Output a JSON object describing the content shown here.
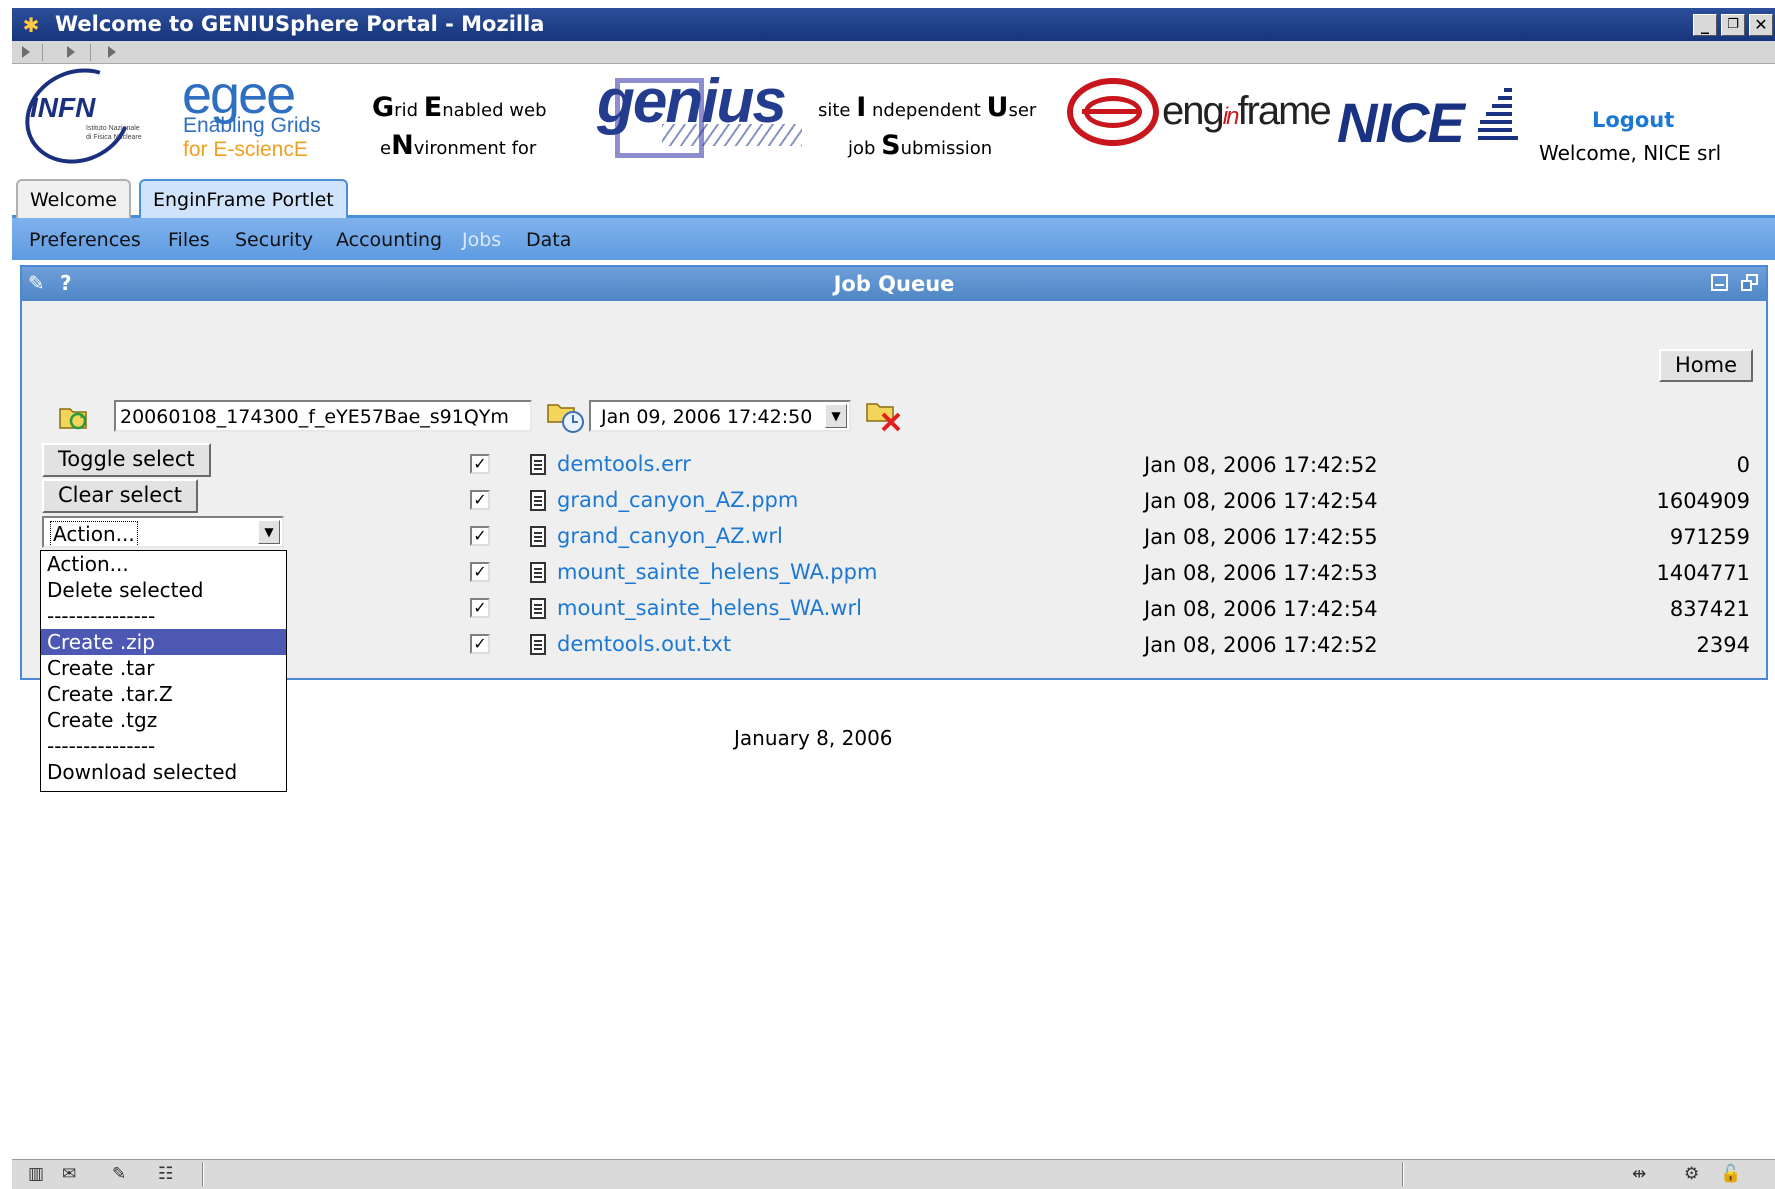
{
  "window": {
    "title": "Welcome to GENIUSphere Portal - Mozilla",
    "controls": [
      "_",
      "❐",
      "✕"
    ]
  },
  "header": {
    "infn": {
      "name": "INFN",
      "small_line1": "Istituto Nazionale",
      "small_line2": "di Fisica Nucleare"
    },
    "egee": {
      "name": "egee",
      "line1": "Enabling Grids",
      "line2": "for E-sciencE"
    },
    "genius_acronym": {
      "g": "G",
      "g_rest": "rid ",
      "e": "E",
      "e_rest": "nabled web",
      "e2": "e",
      "n": "N",
      "n_rest": "vironment for"
    },
    "genius_logo": "genius",
    "iuser_acronym": {
      "site": "site ",
      "i": "I",
      "i_rest": " ndependent ",
      "u": "U",
      "u_rest": "ser",
      "job": "job ",
      "s": "S",
      "s_rest": "ubmission"
    },
    "enginframe": {
      "pre": "eng",
      "mid": "in",
      "post": "frame"
    },
    "nice": "NICE",
    "logout": "Logout",
    "welcome_user": "Welcome, NICE srl"
  },
  "tabs": [
    {
      "label": "Welcome",
      "active": false
    },
    {
      "label": "EnginFrame Portlet",
      "active": true
    }
  ],
  "submenu": [
    {
      "label": "Preferences"
    },
    {
      "label": "Files"
    },
    {
      "label": "Security"
    },
    {
      "label": "Accounting"
    },
    {
      "label": "Jobs",
      "current": true
    },
    {
      "label": "Data"
    }
  ],
  "portlet": {
    "title": "Job Queue",
    "edit_icon": "✎",
    "help_icon": "?",
    "home_button": "Home",
    "spooler_value": "20060108_174300_f_eYE57Bae_s91QYm",
    "date_combo_value": "Jan 09, 2006 17:42:50",
    "toggle_select": "Toggle select",
    "clear_select": "Clear select",
    "action_select_value": "Action...",
    "action_options": [
      "Action...",
      "Delete selected",
      "---------------",
      "Create .zip",
      "Create .tar",
      "Create .tar.Z",
      "Create .tgz",
      "---------------",
      "Download selected"
    ],
    "action_selected_option": "Create .zip",
    "files": [
      {
        "checked": true,
        "name": "demtools.err",
        "date": "Jan 08, 2006 17:42:52",
        "size": "0"
      },
      {
        "checked": true,
        "name": "grand_canyon_AZ.ppm",
        "date": "Jan 08, 2006 17:42:54",
        "size": "1604909"
      },
      {
        "checked": true,
        "name": "grand_canyon_AZ.wrl",
        "date": "Jan 08, 2006 17:42:55",
        "size": "971259"
      },
      {
        "checked": true,
        "name": "mount_sainte_helens_WA.ppm",
        "date": "Jan 08, 2006 17:42:53",
        "size": "1404771"
      },
      {
        "checked": true,
        "name": "mount_sainte_helens_WA.wrl",
        "date": "Jan 08, 2006 17:42:54",
        "size": "837421"
      },
      {
        "checked": true,
        "name": "demtools.out.txt",
        "date": "Jan 08, 2006 17:42:52",
        "size": "2394"
      }
    ]
  },
  "footer_date": "January 8, 2006",
  "colors": {
    "title_bar": "#16357c",
    "link": "#1b78d4",
    "portlet_header": "#4f86c7",
    "selected_option": "#4c58b4"
  }
}
